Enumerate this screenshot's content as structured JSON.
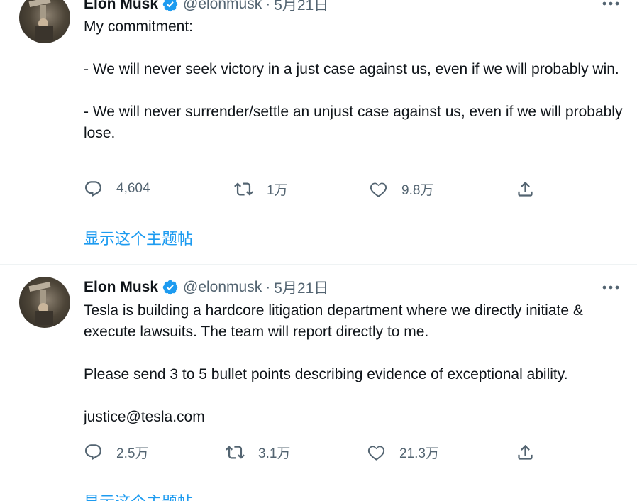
{
  "tweets": [
    {
      "name": "Elon Musk",
      "handle": "@elonmusk",
      "separator": "·",
      "date": "5月21日",
      "body": [
        "My commitment:",
        "- We will never seek victory in a just case against us, even if we will probably win.",
        "- We will never surrender/settle an unjust case against us, even if we will probably lose."
      ],
      "reply_count": "4,604",
      "retweet_count": "1万",
      "like_count": "9.8万",
      "thread_link": "显示这个主题帖"
    },
    {
      "name": "Elon Musk",
      "handle": "@elonmusk",
      "separator": "·",
      "date": "5月21日",
      "body": [
        "Tesla is building a hardcore litigation department where we directly initiate & execute lawsuits. The team will report directly to me.",
        "Please send 3 to 5 bullet points describing evidence of exceptional ability.",
        "justice@tesla.com"
      ],
      "reply_count": "2.5万",
      "retweet_count": "3.1万",
      "like_count": "21.3万",
      "thread_link": "显示这个主题帖"
    }
  ],
  "icons": {
    "reply": "reply-icon",
    "retweet": "retweet-icon",
    "like": "heart-icon",
    "share": "share-icon",
    "more": "more-icon",
    "verified": "verified-badge-icon"
  },
  "colors": {
    "text": "#0f1419",
    "secondary": "#536471",
    "link": "#1d9bf0",
    "verified": "#1d9bf0"
  }
}
